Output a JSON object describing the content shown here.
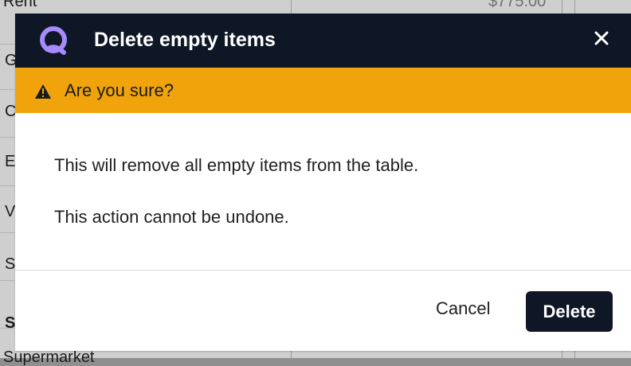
{
  "background": {
    "row_labels": [
      "Rent",
      "G",
      "C",
      "E",
      "V",
      "S",
      "S",
      "Supermarket"
    ],
    "amount_snippet": "$775.00"
  },
  "dialog": {
    "title": "Delete empty items",
    "close_label": "×",
    "warning": "Are you sure?",
    "messages": [
      "This will remove all empty items from the table.",
      "This action cannot be undone."
    ],
    "buttons": {
      "cancel": "Cancel",
      "delete": "Delete"
    }
  },
  "icons": {
    "logo": "app-logo-icon",
    "close": "close-icon",
    "warning": "warning-icon"
  },
  "colors": {
    "header_bg": "#0f1726",
    "warning_bg": "#f0a30a",
    "button_bg": "#0f1726",
    "accent": "#a78bfa"
  }
}
